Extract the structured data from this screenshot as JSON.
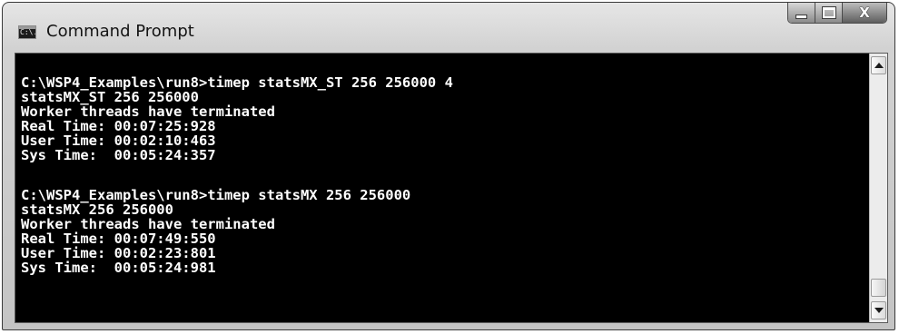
{
  "window": {
    "title": "Command Prompt",
    "icon": "cmd-console-icon",
    "icon_text": "C:\\."
  },
  "controls": {
    "minimize_icon": "minimize-icon",
    "maximize_icon": "maximize-icon",
    "close_icon": "close-icon",
    "close_glyph": "X"
  },
  "console": {
    "background": "#000000",
    "foreground": "#ffffff",
    "lines": [
      "C:\\WSP4_Examples\\run8>timep statsMX_ST 256 256000 4",
      "statsMX_ST 256 256000",
      "Worker threads have terminated",
      "Real Time: 00:07:25:928",
      "User Time: 00:02:10:463",
      "Sys Time:  00:05:24:357",
      "",
      "C:\\WSP4_Examples\\run8>timep statsMX 256 256000",
      "statsMX 256 256000",
      "Worker threads have terminated",
      "Real Time: 00:07:49:550",
      "User Time: 00:02:23:801",
      "Sys Time:  00:05:24:981"
    ]
  },
  "scrollbar": {
    "up_icon": "scroll-up-arrow-icon",
    "down_icon": "scroll-down-arrow-icon"
  }
}
